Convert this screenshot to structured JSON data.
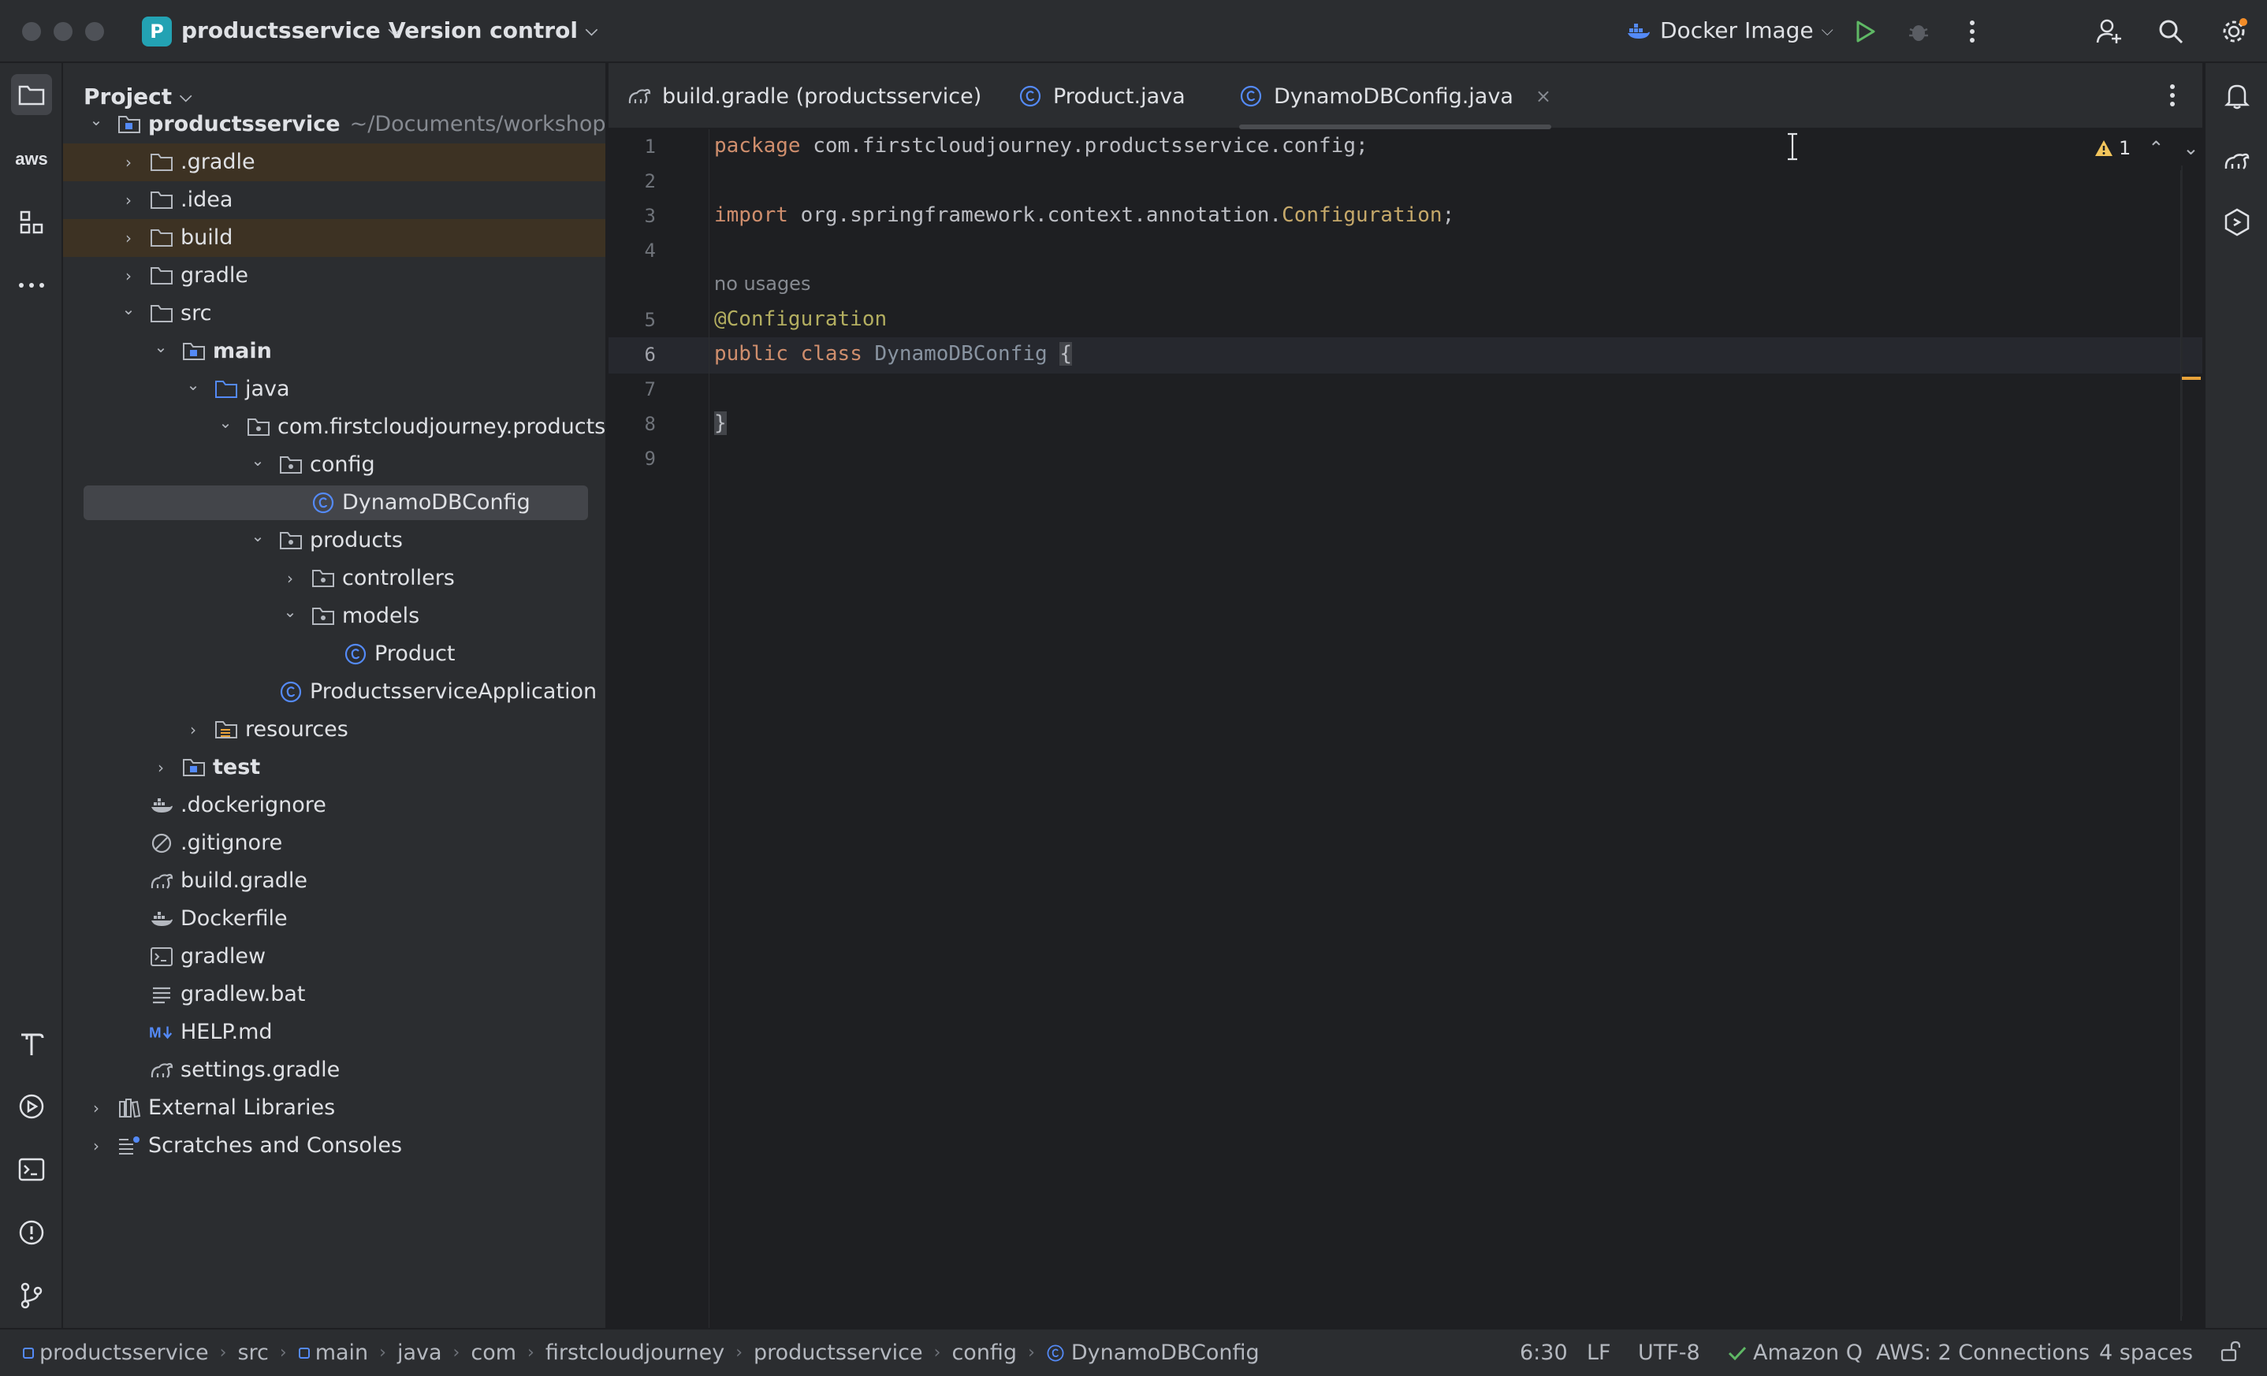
{
  "titlebar": {
    "project_initial": "P",
    "project_name": "productsservice",
    "version_control": "Version control",
    "run_config": "Docker Image"
  },
  "project_panel": {
    "title": "Project",
    "tree": [
      {
        "label": "productsservice",
        "hint": "~/Documents/workshope/proc",
        "bold": true,
        "icon": "module-folder-icon",
        "arrow": "expanded"
      },
      {
        "label": ".gradle",
        "icon": "folder-icon",
        "arrow": "collapsed",
        "excluded": true
      },
      {
        "label": ".idea",
        "icon": "folder-icon",
        "arrow": "collapsed"
      },
      {
        "label": "build",
        "icon": "folder-icon",
        "arrow": "collapsed",
        "excluded": true
      },
      {
        "label": "gradle",
        "icon": "folder-icon",
        "arrow": "collapsed"
      },
      {
        "label": "src",
        "icon": "folder-icon",
        "arrow": "expanded"
      },
      {
        "label": "main",
        "icon": "module-folder-icon",
        "arrow": "expanded",
        "bold": true
      },
      {
        "label": "java",
        "icon": "source-folder-icon",
        "arrow": "expanded"
      },
      {
        "label": "com.firstcloudjourney.productsserv",
        "icon": "package-icon",
        "arrow": "expanded"
      },
      {
        "label": "config",
        "icon": "package-icon",
        "arrow": "expanded"
      },
      {
        "label": "DynamoDBConfig",
        "icon": "java-class-icon",
        "selected": true
      },
      {
        "label": "products",
        "icon": "package-icon",
        "arrow": "expanded"
      },
      {
        "label": "controllers",
        "icon": "package-icon",
        "arrow": "collapsed"
      },
      {
        "label": "models",
        "icon": "package-icon",
        "arrow": "expanded"
      },
      {
        "label": "Product",
        "icon": "java-class-icon"
      },
      {
        "label": "ProductsserviceApplication",
        "icon": "java-class-icon"
      },
      {
        "label": "resources",
        "icon": "resources-folder-icon",
        "arrow": "collapsed"
      },
      {
        "label": "test",
        "icon": "module-folder-icon",
        "arrow": "collapsed",
        "bold": true
      },
      {
        "label": ".dockerignore",
        "icon": "docker-icon"
      },
      {
        "label": ".gitignore",
        "icon": "ignore-file-icon"
      },
      {
        "label": "build.gradle",
        "icon": "gradle-icon"
      },
      {
        "label": "Dockerfile",
        "icon": "docker-icon"
      },
      {
        "label": "gradlew",
        "icon": "terminal-file-icon"
      },
      {
        "label": "gradlew.bat",
        "icon": "text-file-icon"
      },
      {
        "label": "HELP.md",
        "icon": "markdown-icon"
      },
      {
        "label": "settings.gradle",
        "icon": "gradle-icon"
      },
      {
        "label": "External Libraries",
        "icon": "library-icon",
        "arrow": "collapsed"
      },
      {
        "label": "Scratches and Consoles",
        "icon": "scratches-icon",
        "arrow": "collapsed"
      }
    ]
  },
  "tabs": [
    {
      "label": "build.gradle (productsservice)",
      "icon": "gradle-icon"
    },
    {
      "label": "Product.java",
      "icon": "java-class-icon"
    },
    {
      "label": "DynamoDBConfig.java",
      "icon": "java-class-icon",
      "active": true,
      "close": "×"
    }
  ],
  "editor": {
    "warning_count": "1",
    "code_vision_hint": "no usages",
    "line_numbers": [
      "1",
      "2",
      "3",
      "4",
      "5",
      "6",
      "7",
      "8",
      "9"
    ],
    "lines": {
      "l1_kw": "package",
      "l1_rest": " com.firstcloudjourney.productsservice.config;",
      "l3_kw": "import",
      "l3_mid": " org.springframework.context.annotation.",
      "l3_ref": "Configuration",
      "l3_end": ";",
      "l5": "@Configuration",
      "l6_kw1": "public",
      "l6_kw2": "class",
      "l6_name": "DynamoDBConfig",
      "l6_brace": "{",
      "l8": "}"
    }
  },
  "statusbar": {
    "breadcrumbs": [
      "productsservice",
      "src",
      "main",
      "java",
      "com",
      "firstcloudjourney",
      "productsservice",
      "config",
      "DynamoDBConfig"
    ],
    "cursor": "6:30",
    "line_sep": "LF",
    "encoding": "UTF-8",
    "amazon_q": "Amazon Q",
    "aws": "AWS: 2 Connections",
    "indent": "4 spaces"
  },
  "colors": {
    "accent_blue": "#548af7",
    "excluded_bg": "#3d3223",
    "run_green": "#5fb865",
    "warning_yellow": "#f2c55c"
  }
}
